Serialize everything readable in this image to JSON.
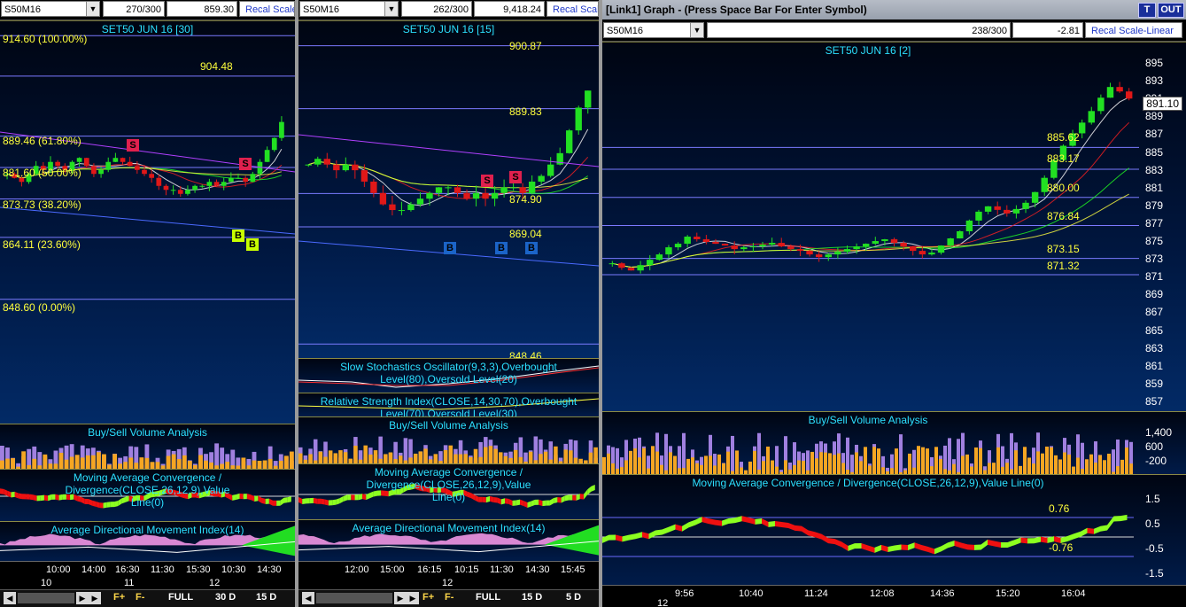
{
  "panels": [
    {
      "symbol": "S50M16",
      "bars": "270/300",
      "price": "859.30",
      "recal": "Recal Scale",
      "chart_title": "SET50 JUN 16  [30]",
      "levels": [
        "914.60 (100.00%)",
        "904.48",
        "889.46 (61.80%)",
        "881.60 (50.00%)",
        "873.73 (38.20%)",
        "864.11 (23.60%)",
        "848.60 (0.00%)"
      ],
      "indicators": {
        "volume": "Buy/Sell Volume Analysis",
        "macd": "Moving Average Convergence / Divergence(CLOSE,26,12,9),Value Line(0)",
        "adx": "Average Directional Movement Index(14)"
      },
      "time_ticks": [
        "10:00",
        "14:00",
        "16:30",
        "11:30",
        "15:30",
        "10:30",
        "14:30"
      ],
      "day_ticks": [
        "10",
        "11",
        "12"
      ],
      "bottom": [
        "FULL",
        "30 D",
        "15 D"
      ]
    },
    {
      "symbol": "S50M16",
      "bars": "262/300",
      "price": "9,418.24",
      "recal": "Recal Scale",
      "chart_title": "SET50 JUN 16  [15]",
      "levels": [
        "900.87",
        "889.83",
        "874.90",
        "869.04",
        "848.46"
      ],
      "indicators": {
        "stoch": "Slow Stochastics Oscillator(9,3,3),Overbought Level(80),Oversold Level(20)",
        "rsi": "Relative Strength Index(CLOSE,14,30,70),Overbought Level(70),Oversold Level(30)",
        "volume": "Buy/Sell Volume Analysis",
        "macd": "Moving Average Convergence / Divergence(CLOSE,26,12,9),Value Line(0)",
        "adx": "Average Directional Movement Index(14)"
      },
      "time_ticks": [
        "12:00",
        "15:00",
        "16:15",
        "10:15",
        "11:30",
        "14:30",
        "15:45"
      ],
      "day_ticks": [
        "12"
      ],
      "bottom": [
        "FULL",
        "15 D",
        "5 D"
      ]
    },
    {
      "window_title": "[Link1] Graph  - (Press Space Bar For Enter Symbol)",
      "title_buttons": [
        "T",
        "OUT"
      ],
      "symbol": "S50M16",
      "bars": "238/300",
      "price": "-2.81",
      "recal": "Recal Scale-Linear",
      "chart_title": "SET50 JUN 16  [2]",
      "last_price": "891.10",
      "levels": [
        "885.62",
        "883.17",
        "880.00",
        "876.84",
        "873.15",
        "871.32"
      ],
      "y_ticks": [
        "895",
        "893",
        "891",
        "889",
        "887",
        "885",
        "883",
        "881",
        "879",
        "877",
        "875",
        "873",
        "871",
        "869",
        "867",
        "865",
        "863",
        "861",
        "859",
        "857"
      ],
      "vol_ticks": [
        "1,400",
        "600",
        "-200"
      ],
      "macd_ticks": [
        "1.5",
        "0.5",
        "-0.5",
        "-1.5"
      ],
      "macd_levels": [
        "0.76",
        "-0.76"
      ],
      "indicators": {
        "volume": "Buy/Sell Volume Analysis",
        "macd": "Moving Average Convergence / Divergence(CLOSE,26,12,9),Value Line(0)"
      },
      "time_ticks": [
        "9:56",
        "10:40",
        "11:24",
        "12:08",
        "14:36",
        "15:20",
        "16:04"
      ],
      "day_ticks": [
        "12"
      ]
    }
  ],
  "signals": {
    "sell": "S",
    "buy": "B"
  },
  "colors": {
    "bull": "#22e022",
    "bear": "#e01818",
    "fib": "#ffff3c",
    "title": "#2ce0ff",
    "vol_buy": "#f5a623",
    "vol_sell": "#a080e0",
    "macd_pos": "#8cff20",
    "macd_neg": "#ee1010",
    "adx_pink": "#ff9ef0",
    "adx_green": "#22dd22"
  },
  "chart_data": [
    {
      "type": "candlestick",
      "title": "SET50 JUN 16  [30]",
      "ylim": [
        845,
        916
      ],
      "fib_levels": [
        914.6,
        904.48,
        889.46,
        881.6,
        873.73,
        864.11,
        848.6
      ],
      "series": [
        {
          "name": "SET50 JUN 16",
          "close": [
            880,
            879,
            878,
            880,
            882,
            881,
            883,
            882,
            881,
            883,
            884,
            882,
            880,
            881,
            883,
            884,
            883,
            882,
            881,
            880,
            879,
            877,
            876,
            876,
            875,
            876,
            877,
            877,
            878,
            877,
            878,
            879,
            879,
            878,
            880,
            883,
            886,
            889,
            893
          ]
        }
      ]
    },
    {
      "type": "candlestick",
      "title": "SET50 JUN 16  [15]",
      "ylim": [
        846,
        903
      ],
      "levels": [
        900.87,
        889.83,
        874.9,
        869.04,
        848.46
      ],
      "series": [
        {
          "name": "SET50 JUN 16",
          "close": [
            880,
            881,
            880,
            879,
            880,
            879,
            877,
            875,
            873,
            872,
            872,
            873,
            874,
            875,
            876,
            876,
            875,
            874,
            875,
            874,
            875,
            876,
            876,
            875,
            877,
            878,
            880,
            882,
            886,
            890,
            893
          ]
        }
      ]
    },
    {
      "type": "candlestick",
      "title": "SET50 JUN 16  [2]",
      "ylim": [
        856,
        896
      ],
      "levels": [
        885.62,
        883.17,
        880.0,
        876.84,
        873.15,
        871.32
      ],
      "series": [
        {
          "name": "SET50 JUN 16",
          "close": [
            872.6,
            872.1,
            871.8,
            872.4,
            873.0,
            873.6,
            874.4,
            874.8,
            875.6,
            875.3,
            875.0,
            874.8,
            874.6,
            874.2,
            874.4,
            874.5,
            874.7,
            874.9,
            874.5,
            874.2,
            874.0,
            873.6,
            873.3,
            873.6,
            873.9,
            874.2,
            874.5,
            874.8,
            875.1,
            875.3,
            874.9,
            874.5,
            874.0,
            873.6,
            873.8,
            874.6,
            875.4,
            876.2,
            877.4,
            878.4,
            879.0,
            878.6,
            878.2,
            878.7,
            879.4,
            880.6,
            882.2,
            884.2,
            885.8,
            887.2,
            888.4,
            889.7,
            891.2,
            892.4,
            891.9,
            891.1
          ]
        }
      ]
    }
  ]
}
